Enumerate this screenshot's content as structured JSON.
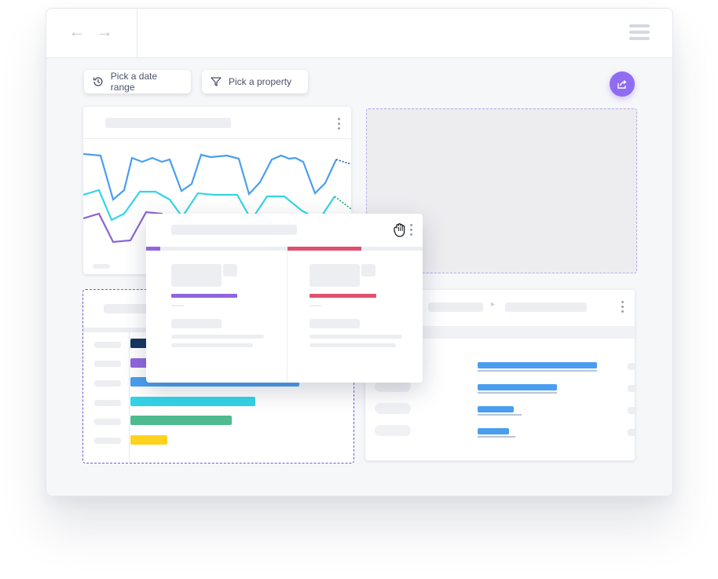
{
  "toolbar": {
    "date_range_label": "Pick a date range",
    "date_range_icon": "history-icon",
    "property_label": "Pick a property",
    "property_icon": "filter-icon",
    "share_icon": "share-icon"
  },
  "nav": {
    "back_glyph": "←",
    "forward_glyph": "→",
    "menu_icon": "hamburger-icon"
  },
  "colors": {
    "accent": "#8f6cf2",
    "line_blue": "#4a9eef",
    "line_cyan": "#33d6e6",
    "line_purple": "#8a63d8",
    "bar_navy": "#16365e",
    "bar_purple": "#9066df",
    "bar_blue": "#4a9eef",
    "bar_cyan": "#33d3e8",
    "bar_green": "#4dbb8f",
    "bar_yellow": "#ffd21f",
    "metric_purple": "#9066df",
    "metric_red": "#e0506f"
  },
  "drag_cursor_icon": "grab-hand-icon",
  "bar_chart": {
    "values": [
      0.14,
      0.3,
      0.5,
      0.37,
      0.3,
      0.11
    ]
  },
  "table_rows": [
    {
      "value": 0.95,
      "sort": "up"
    },
    {
      "value": 0.63,
      "sort": "up"
    },
    {
      "value": 0.29,
      "sort": "down"
    },
    {
      "value": 0.25,
      "sort": "down"
    }
  ]
}
